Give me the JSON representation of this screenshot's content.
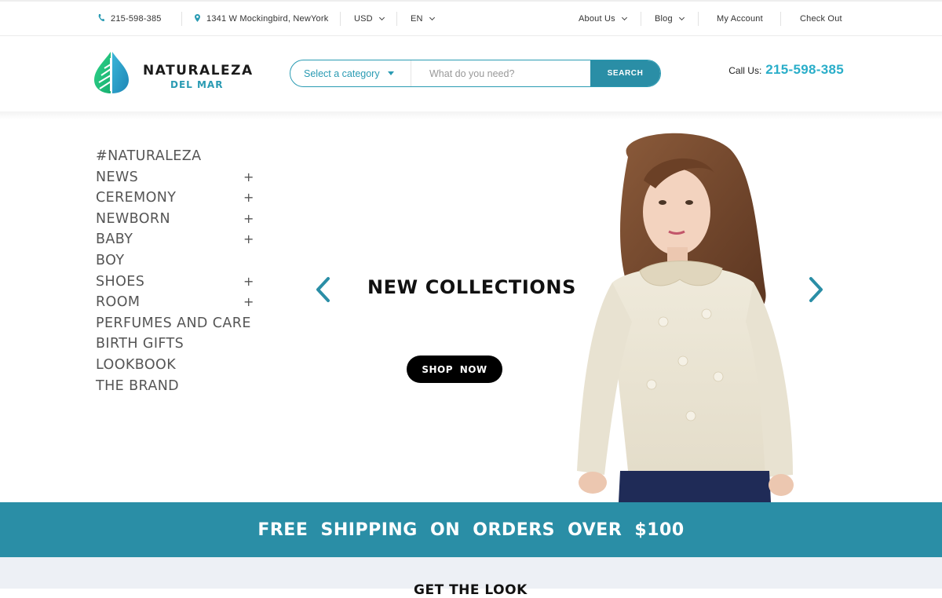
{
  "topbar": {
    "phone": "215-598-385",
    "address": "1341 W Mockingbird, NewYork",
    "currency": "USD",
    "language": "EN",
    "about": "About Us",
    "blog": "Blog",
    "account": "My Account",
    "checkout": "Check Out"
  },
  "header": {
    "logo_name": "NATURALEZA",
    "logo_sub": "DEL MAR",
    "search": {
      "category": "Select a category",
      "placeholder": "What do you need?",
      "button": "SEARCH"
    },
    "call_label": "Call Us:",
    "call_number": "215-598-385"
  },
  "menu": {
    "items": [
      {
        "label": "#NATURALEZA",
        "expand": ""
      },
      {
        "label": "NEWS",
        "expand": "+"
      },
      {
        "label": "CEREMONY",
        "expand": "+"
      },
      {
        "label": "NEWBORN",
        "expand": "+"
      },
      {
        "label": "BABY",
        "expand": "+"
      },
      {
        "label": "BOY",
        "expand": ""
      },
      {
        "label": "SHOES",
        "expand": "+"
      },
      {
        "label": "ROOM",
        "expand": "+"
      },
      {
        "label": "PERFUMES AND CARE",
        "expand": ""
      },
      {
        "label": "BIRTH GIFTS",
        "expand": ""
      },
      {
        "label": "LOOKBOOK",
        "expand": ""
      },
      {
        "label": "THE BRAND",
        "expand": ""
      }
    ]
  },
  "hero": {
    "title": "NEW COLLECTIONS",
    "cta": "SHOP NOW"
  },
  "promo": {
    "text": "FREE SHIPPING ON ORDERS OVER $100"
  },
  "section": {
    "title": "GET THE LOOK"
  },
  "colors": {
    "accent": "#2a9bb3",
    "band": "#2a8ea6",
    "cta": "#000000"
  }
}
